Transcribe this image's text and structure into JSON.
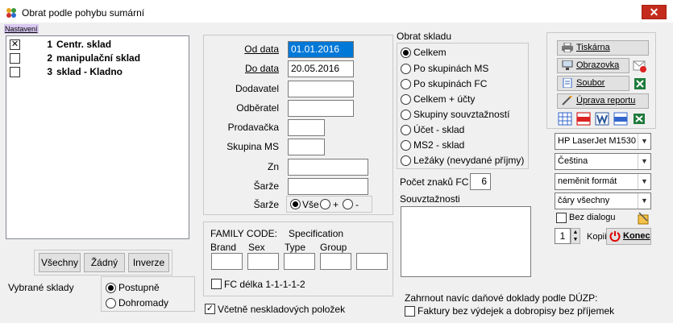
{
  "window": {
    "title": "Obrat podle pohybu sumární",
    "close_glyph": "✕"
  },
  "menu": {
    "nastaveni": "Nastavení"
  },
  "warehouses": [
    {
      "checked": true,
      "num": "1",
      "name": "Centr. sklad"
    },
    {
      "checked": false,
      "num": "2",
      "name": "manipulační sklad"
    },
    {
      "checked": false,
      "num": "3",
      "name": "sklad - Kladno"
    }
  ],
  "list_buttons": {
    "all": "Všechny",
    "none": "Žádný",
    "invert": "Inverze"
  },
  "selected_warehouses": {
    "label": "Vybrané sklady",
    "opt1": "Postupně",
    "opt2": "Dohromady",
    "selected": "Postupně"
  },
  "filters": {
    "od_label": "Od data",
    "od_value": "01.01.2016",
    "do_label": "Do data",
    "do_value": "20.05.2016",
    "dodavatel": "Dodavatel",
    "odberatel": "Odběratel",
    "prodavacka": "Prodavačka",
    "skupina": "Skupina MS",
    "zn": "Zn",
    "sarze1": "Šarže",
    "sarze2": "Šarže",
    "sarze_opts": [
      "Vše",
      "+",
      "-"
    ],
    "sarze_selected": "Vše"
  },
  "family": {
    "title": "FAMILY CODE:",
    "spec": "Specification",
    "brand": "Brand",
    "sex": "Sex",
    "type": "Type",
    "group": "Group",
    "fc_delka": "FC délka 1-1-1-1-2"
  },
  "vcetne": "Včetně neskladových položek",
  "obrat": {
    "title": "Obrat skladu",
    "options": [
      "Celkem",
      "Po skupinách MS",
      "Po skupinách FC",
      "Celkem + účty",
      "Skupiny souvztažností",
      "Účet - sklad",
      "MS2 - sklad",
      "Ležáky (nevydané příjmy)"
    ],
    "selected": "Celkem"
  },
  "pocet": {
    "label": "Počet znaků FC",
    "value": "6"
  },
  "souvztaznosti": {
    "label": "Souvztažnosti"
  },
  "zahrnout": {
    "label": "Zahrnout navíc daňové doklady podle DÚZP:",
    "faktury": "Faktury bez výdejek a dobropisy bez příjemek"
  },
  "report": {
    "tiskarna": "Tiskárna",
    "obrazovka": "Obrazovka",
    "soubor": "Soubor",
    "uprava": "Úprava reportu"
  },
  "selects": {
    "printer": "HP LaserJet M1530",
    "lang": "Čeština",
    "format": "neměnit formát",
    "lines": "čáry všechny"
  },
  "bez_dialogu": "Bez dialogu",
  "kopii": {
    "value": "1",
    "label": "Kopií"
  },
  "konec": "Konec"
}
